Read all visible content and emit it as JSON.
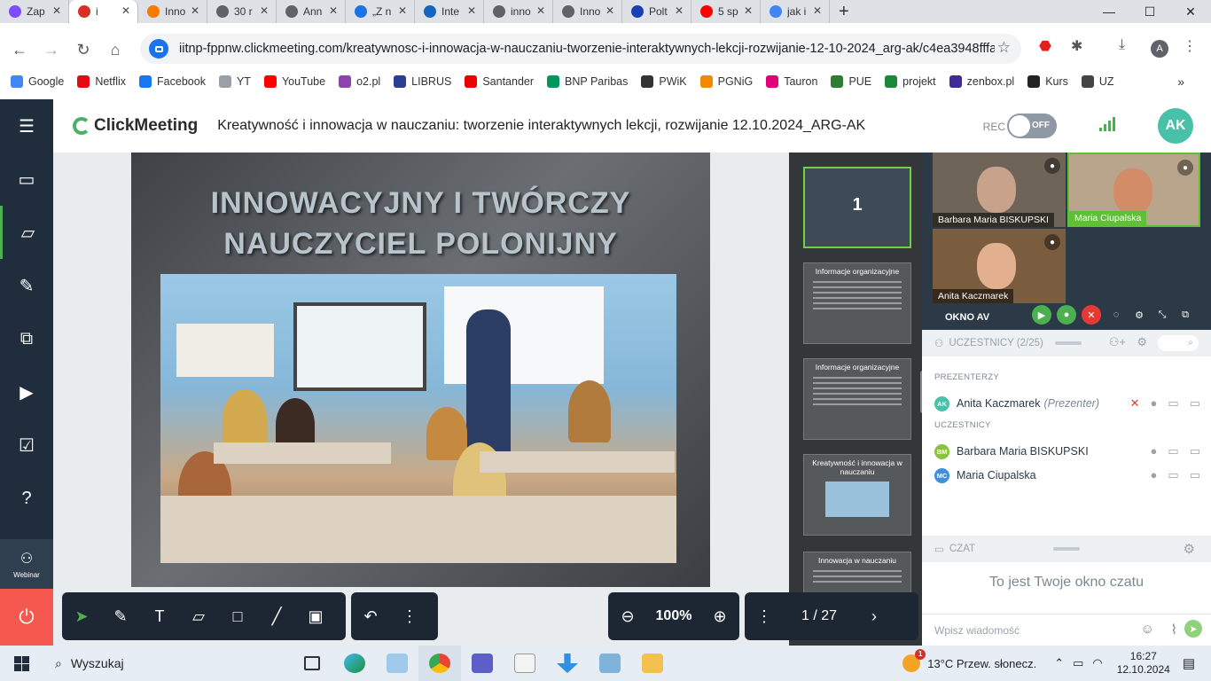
{
  "browser": {
    "tabs": [
      {
        "title": "Zap",
        "color": "#7c4dff"
      },
      {
        "title": "i",
        "color": "#d93025",
        "active": true
      },
      {
        "title": "Inno",
        "color": "#f57c00"
      },
      {
        "title": "30 r",
        "color": "#5f6368"
      },
      {
        "title": "Ann",
        "color": "#5f6368"
      },
      {
        "title": "„Z n",
        "color": "#1a73e8"
      },
      {
        "title": "Inte",
        "color": "#1565c0"
      },
      {
        "title": "inno",
        "color": "#5f6368"
      },
      {
        "title": "Inno",
        "color": "#5f6368"
      },
      {
        "title": "Polt",
        "color": "#1a3fb5"
      },
      {
        "title": "5 sp",
        "color": "#ff0000"
      },
      {
        "title": "jak i",
        "color": "#4285f4"
      }
    ],
    "url": "iitnp-fppnw.clickmeeting.com/kreatywnosc-i-innowacja-w-nauczaniu-tworzenie-interaktywnych-lekcji-rozwijanie-12-10-2024_arg-ak/c4ea3948fffa7...",
    "profile_initial": "A",
    "bookmarks": [
      {
        "label": "Google",
        "color": "#4285f4"
      },
      {
        "label": "Netflix",
        "color": "#e50914"
      },
      {
        "label": "Facebook",
        "color": "#1877f2"
      },
      {
        "label": "YT",
        "color": "#9aa0a6"
      },
      {
        "label": "YouTube",
        "color": "#ff0000"
      },
      {
        "label": "o2.pl",
        "color": "#8e44ad"
      },
      {
        "label": "LIBRUS",
        "color": "#2c3e91"
      },
      {
        "label": "Santander",
        "color": "#ec0000"
      },
      {
        "label": "BNP Paribas",
        "color": "#00965e"
      },
      {
        "label": "PWiK",
        "color": "#333333"
      },
      {
        "label": "PGNiG",
        "color": "#f08a00"
      },
      {
        "label": "Tauron",
        "color": "#e2007a"
      },
      {
        "label": "PUE",
        "color": "#2e7d32"
      },
      {
        "label": "projekt",
        "color": "#1a8a3a"
      },
      {
        "label": "zenbox.pl",
        "color": "#3f2b96"
      },
      {
        "label": "Kurs",
        "color": "#222222"
      },
      {
        "label": "UZ",
        "color": "#444444"
      }
    ]
  },
  "app": {
    "logo": "ClickMeeting",
    "event_title": "Kreatywność i innowacja w nauczaniu: tworzenie interaktywnych lekcji, rozwijanie 12.10.2024_ARG-AK",
    "rec_label": "REC",
    "rec_toggle": "OFF",
    "user_initials": "AK",
    "webinar_label": "Webinar"
  },
  "slide": {
    "title_line1": "INNOWACYJNY I TWÓRCZY",
    "title_line2": "NAUCZYCIEL POLONIJNY"
  },
  "thumbnails": [
    {
      "number": "1",
      "title": ""
    },
    {
      "title": "Informacje organizacyjne"
    },
    {
      "title": "Informacje organizacyjne"
    },
    {
      "title": "Kreatywność i innowacja w nauczaniu"
    },
    {
      "title": "Innowacja w nauczaniu"
    }
  ],
  "videos": [
    {
      "name": "Barbara Maria BISKUPSKI",
      "active": false
    },
    {
      "name": "Maria Ciupalska",
      "active": true
    },
    {
      "name": "Anita Kaczmarek",
      "active": false
    }
  ],
  "av_window_label": "OKNO AV",
  "participants": {
    "header": "UCZESTNICY (2/25)",
    "presenters_label": "PREZENTERZY",
    "attendees_label": "UCZESTNICY",
    "presenters": [
      {
        "initials": "AK",
        "name": "Anita Kaczmarek",
        "role": "(Prezenter)",
        "color": "#49c0a8"
      }
    ],
    "attendees": [
      {
        "initials": "BM",
        "name": "Barbara Maria BISKUPSKI",
        "color": "#8ac43f"
      },
      {
        "initials": "MC",
        "name": "Maria Ciupalska",
        "color": "#3f8fdc"
      }
    ]
  },
  "chat": {
    "header": "CZAT",
    "empty_text": "To jest Twoje okno czatu",
    "input_placeholder": "Wpisz wiadomość"
  },
  "toolbar": {
    "zoom": "100%",
    "page": "1 / 27"
  },
  "taskbar": {
    "search_label": "Wyszukaj",
    "weather": "13°C  Przew. słonecz.",
    "weather_badge": "1",
    "time": "16:27",
    "date": "12.10.2024"
  }
}
